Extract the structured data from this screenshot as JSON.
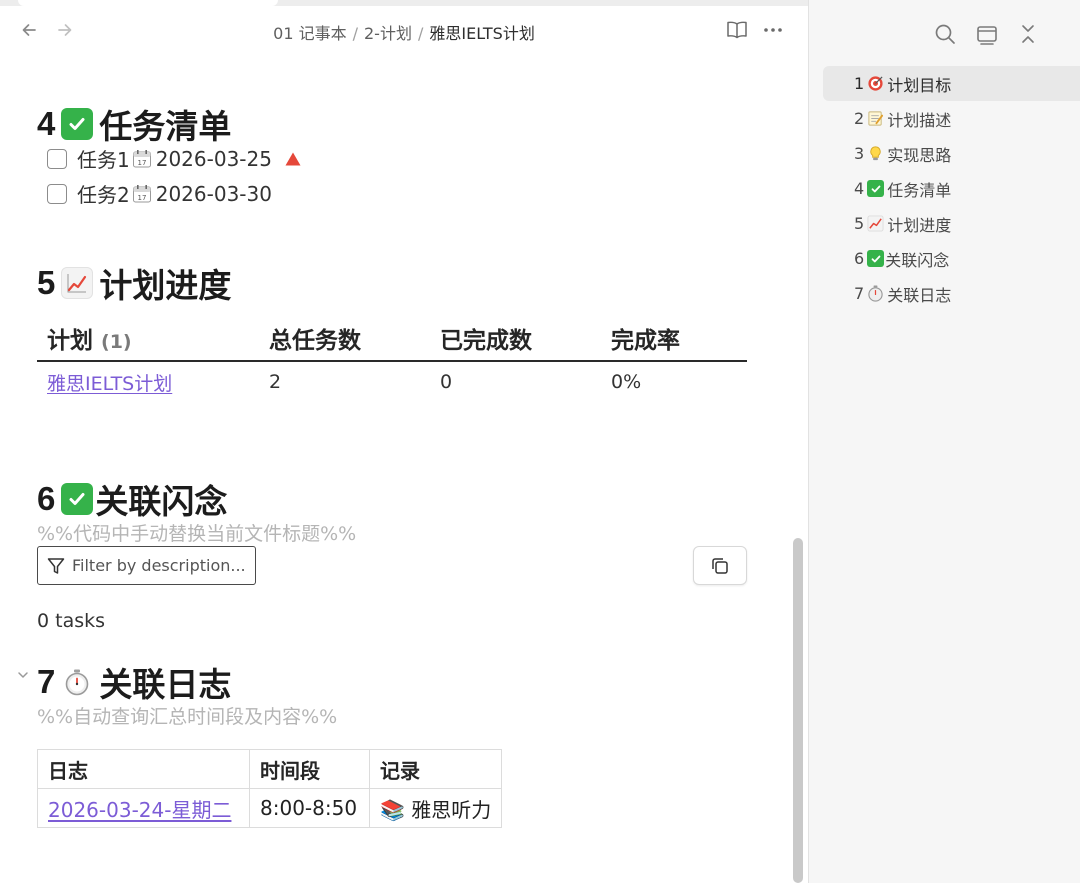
{
  "header": {
    "breadcrumb": [
      "01 记事本",
      "2-计划",
      "雅思IELTS计划"
    ],
    "breadcrumb_separator": "/"
  },
  "sections": {
    "tasks": {
      "num": "4",
      "emoji": "✅",
      "title": "任务清单",
      "items": [
        {
          "label": "任务1",
          "date": "2026-03-25",
          "priority": "high",
          "checked": false
        },
        {
          "label": "任务2",
          "date": "2026-03-30",
          "checked": false
        }
      ]
    },
    "progress": {
      "num": "5",
      "emoji": "📈",
      "title": "计划进度",
      "table": {
        "headers": [
          "计划",
          "总任务数",
          "已完成数",
          "完成率"
        ],
        "count": "(1)",
        "rows": [
          {
            "plan": "雅思IELTS计划",
            "total": "2",
            "done": "0",
            "rate": "0%"
          }
        ]
      }
    },
    "flash": {
      "num": "6",
      "emoji": "✅",
      "title": "关联闪念",
      "comment": "%%代码中手动替换当前文件标题%%",
      "filter_placeholder": "Filter by description...",
      "tasks_count": "0 tasks"
    },
    "log": {
      "num": "7",
      "emoji": "⏱️",
      "title": "关联日志",
      "comment": "%%自动查询汇总时间段及内容%%",
      "table": {
        "headers": [
          "日志",
          "时间段",
          "记录"
        ],
        "rows": [
          {
            "date": "2026-03-24-星期二",
            "time": "8:00-8:50",
            "record_emoji": "📚",
            "record": "雅思听力"
          }
        ]
      }
    }
  },
  "outline": {
    "items": [
      {
        "num": "1",
        "emoji": "🎯",
        "label": "计划目标",
        "active": true
      },
      {
        "num": "2",
        "emoji": "📝",
        "label": "计划描述"
      },
      {
        "num": "3",
        "emoji": "💡",
        "label": "实现思路"
      },
      {
        "num": "4",
        "emoji": "✅",
        "label": "任务清单"
      },
      {
        "num": "5",
        "emoji": "📈",
        "label": "计划进度"
      },
      {
        "num": "6",
        "emoji": "✅",
        "label": "关联闪念"
      },
      {
        "num": "7",
        "emoji": "⏱️",
        "label": "关联日志"
      }
    ]
  },
  "colors": {
    "link": "#7c5cd6",
    "check_green": "#35b24a",
    "priority_red": "#e5483a",
    "muted_text": "#b5b5b5",
    "panel_bg": "#f6f6f6"
  },
  "icons": [
    "back-arrow-icon",
    "forward-arrow-icon",
    "reading-view-icon",
    "more-options-icon",
    "search-icon",
    "window-icon",
    "collapse-all-icon",
    "calendar-icon",
    "priority-triangle-icon",
    "filter-icon",
    "copy-icon",
    "chevron-down-icon"
  ]
}
